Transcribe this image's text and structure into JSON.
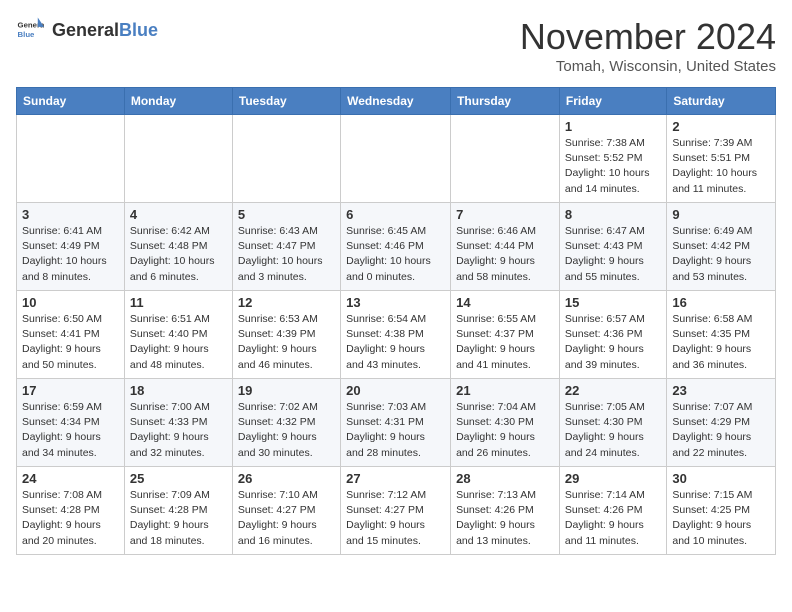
{
  "logo": {
    "text_general": "General",
    "text_blue": "Blue"
  },
  "header": {
    "month": "November 2024",
    "location": "Tomah, Wisconsin, United States"
  },
  "weekdays": [
    "Sunday",
    "Monday",
    "Tuesday",
    "Wednesday",
    "Thursday",
    "Friday",
    "Saturday"
  ],
  "weeks": [
    [
      {
        "day": "",
        "info": ""
      },
      {
        "day": "",
        "info": ""
      },
      {
        "day": "",
        "info": ""
      },
      {
        "day": "",
        "info": ""
      },
      {
        "day": "",
        "info": ""
      },
      {
        "day": "1",
        "info": "Sunrise: 7:38 AM\nSunset: 5:52 PM\nDaylight: 10 hours and 14 minutes."
      },
      {
        "day": "2",
        "info": "Sunrise: 7:39 AM\nSunset: 5:51 PM\nDaylight: 10 hours and 11 minutes."
      }
    ],
    [
      {
        "day": "3",
        "info": "Sunrise: 6:41 AM\nSunset: 4:49 PM\nDaylight: 10 hours and 8 minutes."
      },
      {
        "day": "4",
        "info": "Sunrise: 6:42 AM\nSunset: 4:48 PM\nDaylight: 10 hours and 6 minutes."
      },
      {
        "day": "5",
        "info": "Sunrise: 6:43 AM\nSunset: 4:47 PM\nDaylight: 10 hours and 3 minutes."
      },
      {
        "day": "6",
        "info": "Sunrise: 6:45 AM\nSunset: 4:46 PM\nDaylight: 10 hours and 0 minutes."
      },
      {
        "day": "7",
        "info": "Sunrise: 6:46 AM\nSunset: 4:44 PM\nDaylight: 9 hours and 58 minutes."
      },
      {
        "day": "8",
        "info": "Sunrise: 6:47 AM\nSunset: 4:43 PM\nDaylight: 9 hours and 55 minutes."
      },
      {
        "day": "9",
        "info": "Sunrise: 6:49 AM\nSunset: 4:42 PM\nDaylight: 9 hours and 53 minutes."
      }
    ],
    [
      {
        "day": "10",
        "info": "Sunrise: 6:50 AM\nSunset: 4:41 PM\nDaylight: 9 hours and 50 minutes."
      },
      {
        "day": "11",
        "info": "Sunrise: 6:51 AM\nSunset: 4:40 PM\nDaylight: 9 hours and 48 minutes."
      },
      {
        "day": "12",
        "info": "Sunrise: 6:53 AM\nSunset: 4:39 PM\nDaylight: 9 hours and 46 minutes."
      },
      {
        "day": "13",
        "info": "Sunrise: 6:54 AM\nSunset: 4:38 PM\nDaylight: 9 hours and 43 minutes."
      },
      {
        "day": "14",
        "info": "Sunrise: 6:55 AM\nSunset: 4:37 PM\nDaylight: 9 hours and 41 minutes."
      },
      {
        "day": "15",
        "info": "Sunrise: 6:57 AM\nSunset: 4:36 PM\nDaylight: 9 hours and 39 minutes."
      },
      {
        "day": "16",
        "info": "Sunrise: 6:58 AM\nSunset: 4:35 PM\nDaylight: 9 hours and 36 minutes."
      }
    ],
    [
      {
        "day": "17",
        "info": "Sunrise: 6:59 AM\nSunset: 4:34 PM\nDaylight: 9 hours and 34 minutes."
      },
      {
        "day": "18",
        "info": "Sunrise: 7:00 AM\nSunset: 4:33 PM\nDaylight: 9 hours and 32 minutes."
      },
      {
        "day": "19",
        "info": "Sunrise: 7:02 AM\nSunset: 4:32 PM\nDaylight: 9 hours and 30 minutes."
      },
      {
        "day": "20",
        "info": "Sunrise: 7:03 AM\nSunset: 4:31 PM\nDaylight: 9 hours and 28 minutes."
      },
      {
        "day": "21",
        "info": "Sunrise: 7:04 AM\nSunset: 4:30 PM\nDaylight: 9 hours and 26 minutes."
      },
      {
        "day": "22",
        "info": "Sunrise: 7:05 AM\nSunset: 4:30 PM\nDaylight: 9 hours and 24 minutes."
      },
      {
        "day": "23",
        "info": "Sunrise: 7:07 AM\nSunset: 4:29 PM\nDaylight: 9 hours and 22 minutes."
      }
    ],
    [
      {
        "day": "24",
        "info": "Sunrise: 7:08 AM\nSunset: 4:28 PM\nDaylight: 9 hours and 20 minutes."
      },
      {
        "day": "25",
        "info": "Sunrise: 7:09 AM\nSunset: 4:28 PM\nDaylight: 9 hours and 18 minutes."
      },
      {
        "day": "26",
        "info": "Sunrise: 7:10 AM\nSunset: 4:27 PM\nDaylight: 9 hours and 16 minutes."
      },
      {
        "day": "27",
        "info": "Sunrise: 7:12 AM\nSunset: 4:27 PM\nDaylight: 9 hours and 15 minutes."
      },
      {
        "day": "28",
        "info": "Sunrise: 7:13 AM\nSunset: 4:26 PM\nDaylight: 9 hours and 13 minutes."
      },
      {
        "day": "29",
        "info": "Sunrise: 7:14 AM\nSunset: 4:26 PM\nDaylight: 9 hours and 11 minutes."
      },
      {
        "day": "30",
        "info": "Sunrise: 7:15 AM\nSunset: 4:25 PM\nDaylight: 9 hours and 10 minutes."
      }
    ]
  ]
}
